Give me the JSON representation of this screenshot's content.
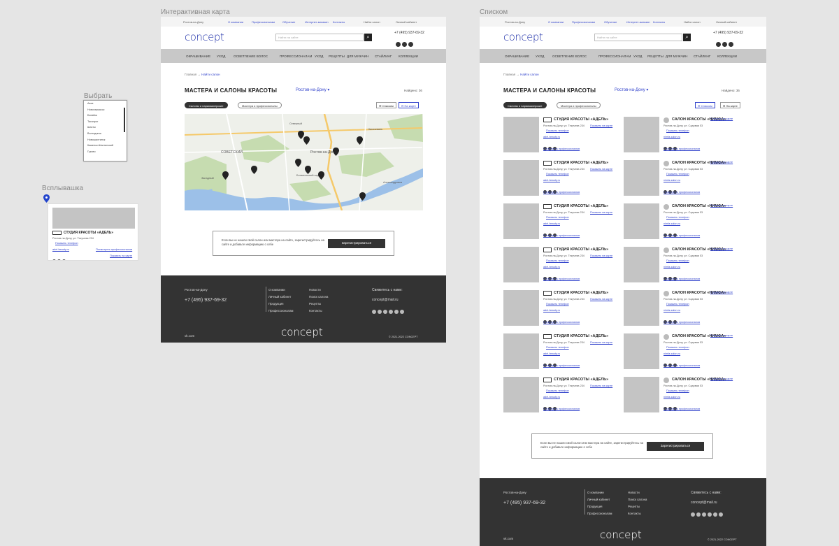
{
  "frames": {
    "map_title": "Интерактивная карта",
    "list_title": "Списком",
    "select_title": "Выбрать",
    "popup_title": "Всплывашка"
  },
  "topbar": {
    "city": "Ростов-на-Дону",
    "links": [
      "О компании",
      "Профессионалам",
      "Обучение",
      "Интернет-магазин",
      "Контакты"
    ],
    "find_salon": "Найти салон",
    "account": "Личный кабинет"
  },
  "header": {
    "logo": "concept",
    "search_placeholder": "Найти на сайте",
    "phone": "+7 (495) 937-69-32"
  },
  "nav": [
    "Окрашивание",
    "Уход",
    "Осветление волос",
    "Профессионалам",
    "Уход",
    "Рецепты",
    "Для мужчин",
    "Стайлинг",
    "Коллекции"
  ],
  "page": {
    "breadcrumb_home": "Главная",
    "breadcrumb_current": "Найти салон",
    "title": "МАСТЕРА И САЛОНЫ КРАСОТЫ",
    "city": "Ростов-на-Дону ▾",
    "found": "Найдено: 36",
    "tab_salons": "Салоны и парикмахерские",
    "tab_masters": "Мастера и профессионалы",
    "view_list": "☰ Списком",
    "view_map": "⊡ На карте"
  },
  "map": {
    "labels": [
      "СОВЕТСКИЙ",
      "Ростов-на-Дону",
      "Нахичевань",
      "Западный",
      "Александровка",
      "Ботанический сад",
      "Северный"
    ]
  },
  "cta": {
    "text": "Если вы не нашли свой салон или мастера на сайте, зарегистрируйтесь на сайте и добавьте информацию о себе",
    "button": "Зарегистрироваться"
  },
  "footer": {
    "city": "Ростов-на-Дону",
    "phone": "+7 (495) 937-69-32",
    "col1": [
      "О компании",
      "Личный кабинет",
      "Продукция",
      "Профессионалам"
    ],
    "col2": [
      "Новости",
      "Поиск салона",
      "Рецепты",
      "Контакты"
    ],
    "subscribe": "Свяжитесь с нами:",
    "email": "concept@mail.ru",
    "logo": "concept",
    "vk": "vk.com",
    "copyright": "© 2021-2022 CONCEPT"
  },
  "select_list": [
    "Азов",
    "Новочеркасск",
    "Батайск",
    "Таганрог",
    "Шахты",
    "Волгодонск",
    "Новошахтинск",
    "Каменск-Шахтинский",
    "Гуково"
  ],
  "popup": {
    "name": "СТУДИЯ КРАСОТЫ «АДЕЛЬ»",
    "address": "Ростов-на-Дону, ул. Текучева 234",
    "phone_link": "Показать телефон",
    "site": "adel-beauty.ru",
    "pro": "Посмотреть профессионалов"
  },
  "list_cards": {
    "left": {
      "name": "СТУДИЯ КРАСОТЫ «АДЕЛЬ»",
      "address": "Ростов-на-Дону, ул. Текучева 234",
      "map_link": "Показать на карте",
      "phone_link": "Показать телефон",
      "site": "adel-beauty.ru",
      "pro": "Посмотреть профессионалов"
    },
    "right": {
      "name": "САЛОН КРАСОТЫ «НИМФА»",
      "address": "Ростов-на-Дону, ул. Садовая 53",
      "map_link": "Показать на карте",
      "phone_link": "Показать телефон",
      "site": "nimfa-salon.ru",
      "pro": "Посмотреть профессионалов"
    }
  }
}
